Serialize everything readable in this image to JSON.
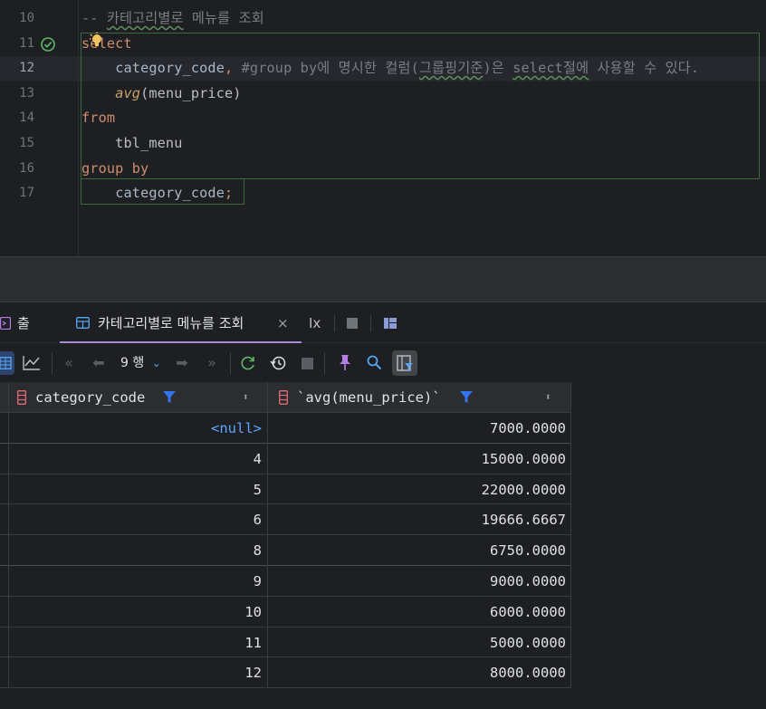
{
  "editor": {
    "line_numbers": [
      "10",
      "11",
      "12",
      "13",
      "14",
      "15",
      "16",
      "17"
    ],
    "lines": [
      [
        {
          "t": "-- ",
          "c": "cm"
        },
        {
          "t": "카테고리별로",
          "c": "cm sq"
        },
        {
          "t": " 메뉴를 조회",
          "c": "cm"
        }
      ],
      [
        {
          "t": "select",
          "c": "kw"
        }
      ],
      [
        {
          "t": "    ",
          "c": "id"
        },
        {
          "t": "category_code",
          "c": "fld"
        },
        {
          "t": ", ",
          "c": "kw"
        },
        {
          "t": "#group by에 명시한 컬럼(",
          "c": "cm"
        },
        {
          "t": "그룹핑기준",
          "c": "cm sq"
        },
        {
          "t": ")은 ",
          "c": "cm"
        },
        {
          "t": "select절에",
          "c": "cm sq"
        },
        {
          "t": " 사용할 수 있다.",
          "c": "cm"
        }
      ],
      [
        {
          "t": "    ",
          "c": "id"
        },
        {
          "t": "avg",
          "c": "fn"
        },
        {
          "t": "(menu_price)",
          "c": "id"
        }
      ],
      [
        {
          "t": "from",
          "c": "kw"
        }
      ],
      [
        {
          "t": "    tbl_menu",
          "c": "id"
        }
      ],
      [
        {
          "t": "group by",
          "c": "kw"
        }
      ],
      [
        {
          "t": "    ",
          "c": "id"
        },
        {
          "t": "category_code",
          "c": "fld"
        },
        {
          "t": ";",
          "c": "kw"
        }
      ]
    ]
  },
  "tabs": {
    "output_label": "출력",
    "result_label": "카테고리별로 메뉴를 조회",
    "close": "×",
    "tx_label": "Ix"
  },
  "toolbar": {
    "rows_label": "9 행",
    "colors": {
      "accent": "#3574f0",
      "green": "#5fb865",
      "pin": "#b57ee5"
    }
  },
  "table": {
    "columns": [
      "category_code",
      "`avg(menu_price)`"
    ],
    "rows": [
      [
        "<null>",
        "7000.0000"
      ],
      [
        "4",
        "15000.0000"
      ],
      [
        "5",
        "22000.0000"
      ],
      [
        "6",
        "19666.6667"
      ],
      [
        "8",
        "6750.0000"
      ],
      [
        "9",
        "9000.0000"
      ],
      [
        "10",
        "6000.0000"
      ],
      [
        "11",
        "5000.0000"
      ],
      [
        "12",
        "8000.0000"
      ]
    ],
    "null_color": "#5aa7ff"
  }
}
